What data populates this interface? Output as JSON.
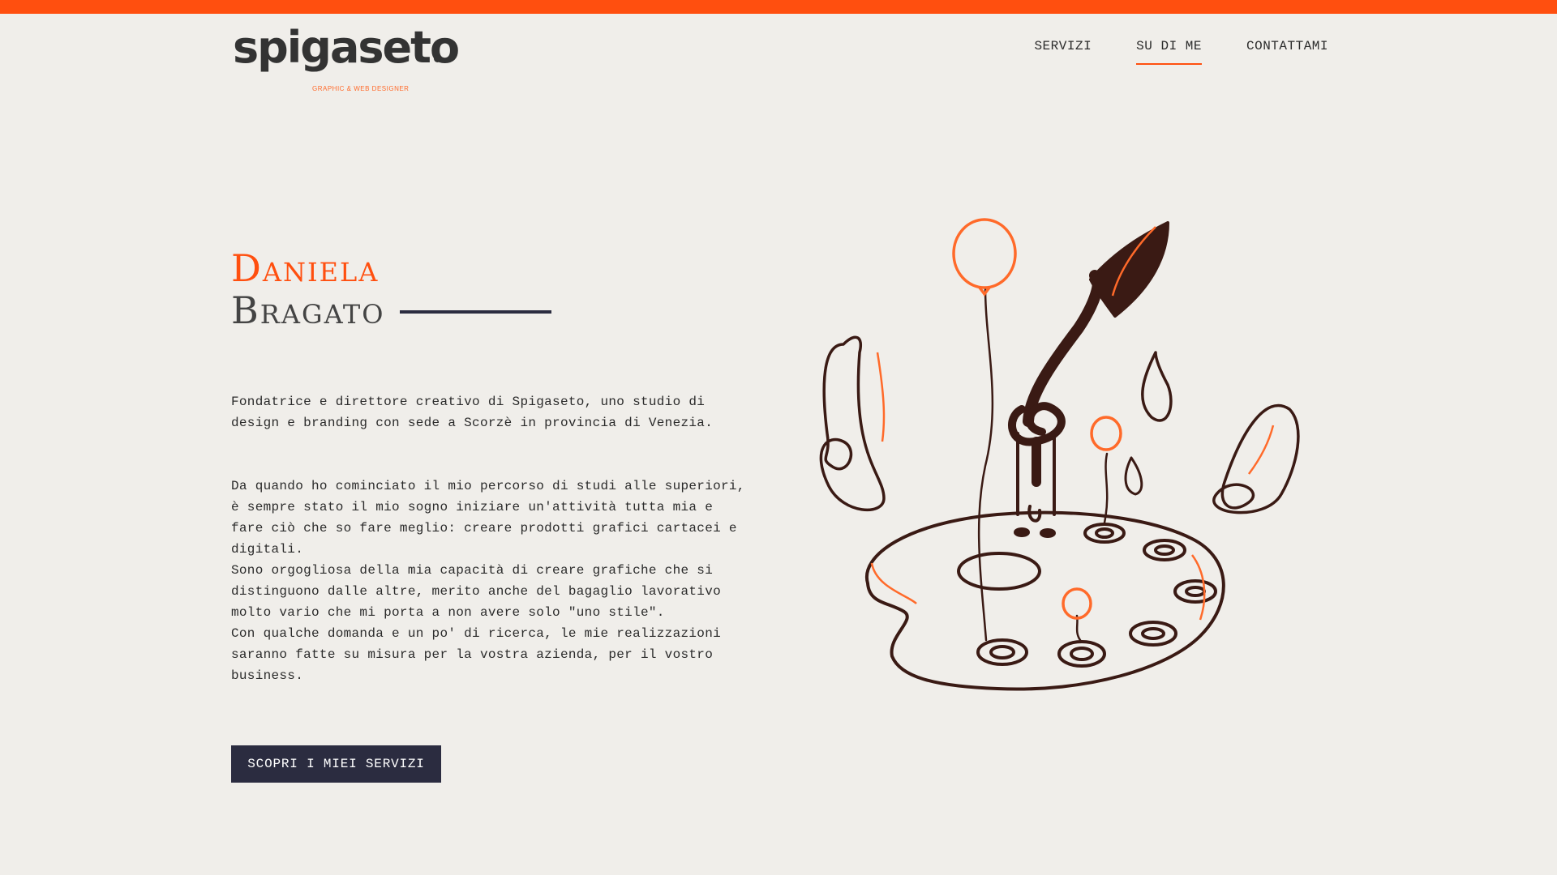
{
  "colors": {
    "accent": "#ff4f0f",
    "dark_navy": "#2b2c40",
    "background": "#f0eeea",
    "illustration_brown": "#3a1a14"
  },
  "logo": {
    "wordmark": "spigaseto",
    "tagline": "GRAPHIC & WEB DESIGNER"
  },
  "nav": {
    "items": [
      {
        "label": "SERVIZI",
        "active": false
      },
      {
        "label": "SU DI ME",
        "active": true
      },
      {
        "label": "CONTATTAMI",
        "active": false
      }
    ]
  },
  "hero": {
    "first_name": "Daniela",
    "last_name": "Bragato"
  },
  "about": {
    "intro": "Fondatrice e direttore creativo di Spigaseto, uno studio di design e branding con sede a Scorzè in provincia di Venezia.",
    "lines": [
      "Da quando ho cominciato il mio percorso di studi alle superiori, è sempre stato il mio sogno iniziare un'attività tutta mia e fare ciò che so fare meglio: creare prodotti grafici cartacei e digitali.",
      "Sono orgogliosa della mia capacità di creare grafiche che si distinguono dalle altre, merito anche del bagaglio lavorativo molto vario che mi porta a non avere solo \"uno stile\".",
      "Con qualche domanda e un po' di ricerca, le mie realizzazioni saranno fatte su misura per la vostra azienda, per il vostro business."
    ]
  },
  "cta": {
    "label": "SCOPRI I MIEI SERVIZI"
  },
  "illustration": {
    "icon": "paint-palette-brush-balloons-illustration"
  }
}
